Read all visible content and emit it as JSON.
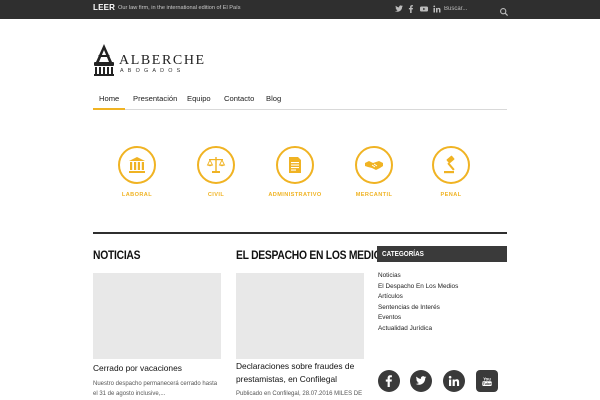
{
  "topbar": {
    "leer_label": "LEER",
    "ticker_text": "Our law firm, in the international edition of El País",
    "social_icons": [
      "twitter-icon",
      "facebook-icon",
      "youtube-icon",
      "linkedin-icon"
    ],
    "search_placeholder": "Buscar..."
  },
  "logo": {
    "name": "ALBERCHE",
    "subtitle": "ABOGADOS"
  },
  "nav": {
    "items": [
      {
        "label": "Home",
        "active": true
      },
      {
        "label": "Presentación",
        "active": false
      },
      {
        "label": "Equipo",
        "active": false
      },
      {
        "label": "Contacto",
        "active": false
      },
      {
        "label": "Blog",
        "active": false
      }
    ]
  },
  "services": [
    {
      "label": "LABORAL",
      "icon": "bank-icon"
    },
    {
      "label": "CIVIL",
      "icon": "scales-icon"
    },
    {
      "label": "ADMINISTRATIVO",
      "icon": "document-icon"
    },
    {
      "label": "MERCANTIL",
      "icon": "handshake-icon"
    },
    {
      "label": "PENAL",
      "icon": "gavel-icon"
    }
  ],
  "columns": {
    "news": {
      "title": "NOTICIAS",
      "post_title": "Cerrado por vacaciones",
      "excerpt_line1": "Nuestro despacho permanecerá cerrado hasta",
      "excerpt_line2": "el 31 de agosto inclusive,..."
    },
    "media": {
      "title": "EL DESPACHO EN LOS MEDIOS",
      "post_title_line1": "Declaraciones sobre fraudes de",
      "post_title_line2": "prestamistas, en Confilegal",
      "excerpt_line1": "Publicado en Confilegal, 28.07.2016 MILES DE"
    }
  },
  "sidebar": {
    "categories_title": "CATEGORÍAS",
    "categories": [
      "Noticias",
      "El Despacho En Los Medios",
      "Artículos",
      "Sentencias de Interés",
      "Eventos",
      "Actualidad Jurídica"
    ],
    "social_icons": [
      "facebook-icon",
      "twitter-icon",
      "linkedin-icon",
      "youtube-icon"
    ]
  },
  "colors": {
    "accent": "#f0b323",
    "topbar": "#2f2f2f",
    "dark": "#3a3a3a"
  }
}
